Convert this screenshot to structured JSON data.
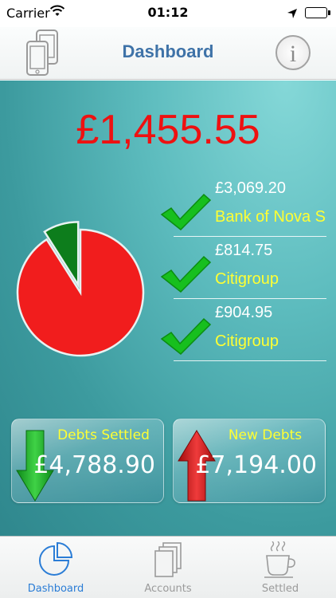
{
  "status_bar": {
    "carrier": "Carrier",
    "time": "01:12"
  },
  "nav": {
    "title": "Dashboard",
    "info_label": "i"
  },
  "dashboard": {
    "total": "£1,455.55",
    "pie_chart": {
      "type": "pie",
      "slices": [
        {
          "value": 91,
          "color": "#f11d1d"
        },
        {
          "value": 9,
          "color": "#0d7d1c"
        }
      ]
    },
    "debts": [
      {
        "amount": "£3,069.20",
        "name": "Bank of Nova Scotia"
      },
      {
        "amount": "£814.75",
        "name": "Citigroup"
      },
      {
        "amount": "£904.95",
        "name": "Citigroup"
      }
    ],
    "settled_card": {
      "title": "Debts Settled",
      "amount": "£4,788.90"
    },
    "new_card": {
      "title": "New Debts",
      "amount": "£7,194.00"
    }
  },
  "tabs": [
    {
      "label": "Dashboard",
      "icon": "pie-chart-icon",
      "active": true
    },
    {
      "label": "Accounts",
      "icon": "stacked-documents-icon",
      "active": false
    },
    {
      "label": "Settled",
      "icon": "coffee-cup-icon",
      "active": false
    }
  ],
  "colors": {
    "total": "#ee1111",
    "accent_yellow": "#ffff33",
    "active_tab": "#2b7dd6",
    "title_blue": "#3f73a8"
  }
}
